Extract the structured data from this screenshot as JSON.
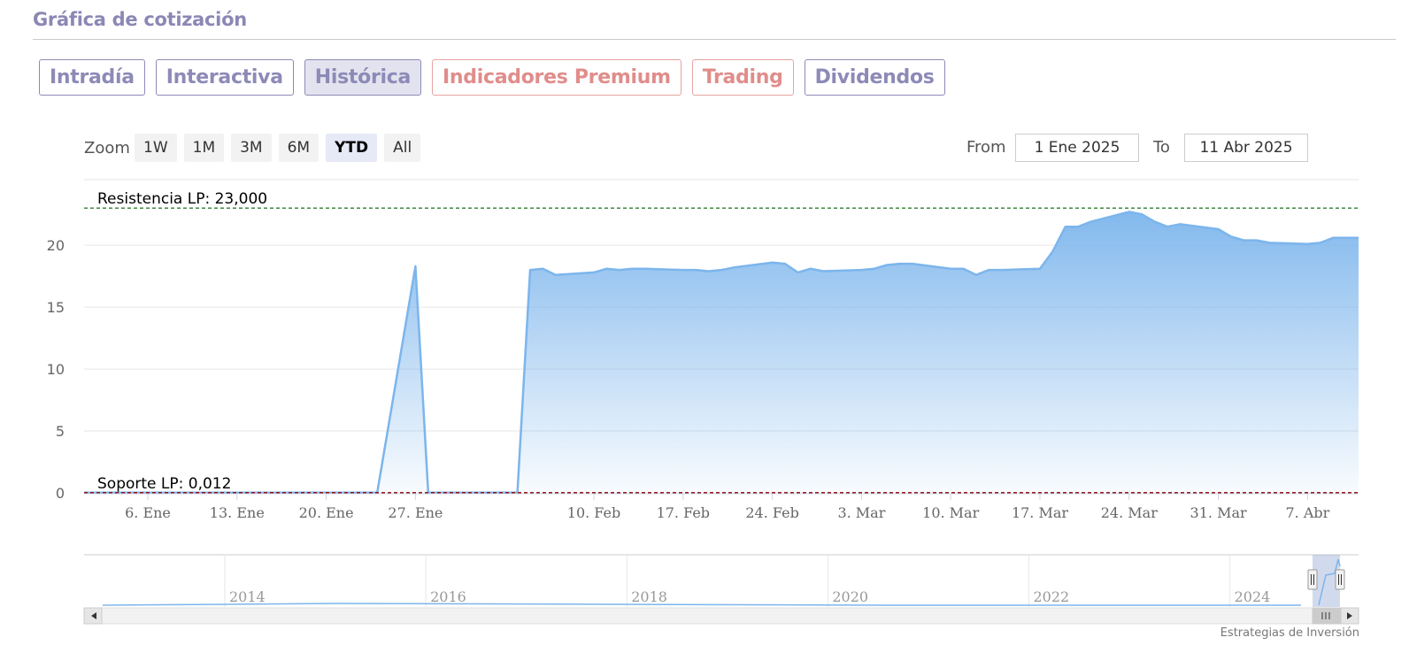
{
  "section_title": "Gráfica de cotización",
  "tabs": [
    {
      "label": "Intradía",
      "style": "normal"
    },
    {
      "label": "Interactiva",
      "style": "normal"
    },
    {
      "label": "Histórica",
      "style": "active"
    },
    {
      "label": "Indicadores Premium",
      "style": "premium"
    },
    {
      "label": "Trading",
      "style": "premium"
    },
    {
      "label": "Dividendos",
      "style": "normal"
    }
  ],
  "range_selector": {
    "zoom_label": "Zoom",
    "buttons": [
      "1W",
      "1M",
      "3M",
      "6M",
      "YTD",
      "All"
    ],
    "selected": "YTD",
    "from_label": "From",
    "from_value": "1 Ene 2025",
    "to_label": "To",
    "to_value": "11 Abr 2025"
  },
  "colors": {
    "accent": "#8d8ab7",
    "premium": "#e08d8b",
    "series_line": "#7cb5ec",
    "resistance_line": "#2e7d32",
    "support_line": "#8b0000"
  },
  "chart_data": {
    "type": "area",
    "x_unit": "date",
    "x": [
      "2025-01-01",
      "2025-01-06",
      "2025-01-13",
      "2025-01-20",
      "2025-01-24",
      "2025-01-27",
      "2025-01-28",
      "2025-02-03",
      "2025-02-04",
      "2025-02-05",
      "2025-02-06",
      "2025-02-07",
      "2025-02-10",
      "2025-02-11",
      "2025-02-12",
      "2025-02-13",
      "2025-02-14",
      "2025-02-17",
      "2025-02-18",
      "2025-02-19",
      "2025-02-20",
      "2025-02-21",
      "2025-02-24",
      "2025-02-25",
      "2025-02-26",
      "2025-02-27",
      "2025-02-28",
      "2025-03-03",
      "2025-03-04",
      "2025-03-05",
      "2025-03-06",
      "2025-03-07",
      "2025-03-10",
      "2025-03-11",
      "2025-03-12",
      "2025-03-13",
      "2025-03-14",
      "2025-03-17",
      "2025-03-18",
      "2025-03-19",
      "2025-03-20",
      "2025-03-21",
      "2025-03-24",
      "2025-03-25",
      "2025-03-26",
      "2025-03-27",
      "2025-03-28",
      "2025-03-31",
      "2025-04-01",
      "2025-04-02",
      "2025-04-03",
      "2025-04-04",
      "2025-04-07",
      "2025-04-08",
      "2025-04-09",
      "2025-04-10",
      "2025-04-11"
    ],
    "y": [
      0.012,
      0.012,
      0.012,
      0.012,
      0.012,
      18.3,
      0.012,
      0.012,
      0.012,
      18.0,
      18.1,
      17.6,
      17.8,
      18.1,
      18.0,
      18.1,
      18.1,
      18.0,
      18.0,
      17.9,
      18.0,
      18.2,
      18.6,
      18.5,
      17.8,
      18.1,
      17.9,
      18.0,
      18.1,
      18.4,
      18.5,
      18.5,
      18.1,
      18.1,
      17.6,
      18.0,
      18.0,
      18.1,
      19.5,
      21.5,
      21.5,
      21.9,
      22.7,
      22.5,
      21.9,
      21.5,
      21.7,
      21.3,
      20.7,
      20.4,
      20.4,
      20.2,
      20.1,
      20.2,
      20.6,
      20.6,
      20.6
    ],
    "ylim": [
      0,
      23
    ],
    "yticks": [
      "0",
      "5",
      "10",
      "15",
      "20"
    ],
    "xticks": [
      "6. Ene",
      "13. Ene",
      "20. Ene",
      "27. Ene",
      "10. Feb",
      "17. Feb",
      "24. Feb",
      "3. Mar",
      "10. Mar",
      "17. Mar",
      "24. Mar",
      "31. Mar",
      "7. Abr"
    ],
    "resistance_label": "Resistencia LP: 23,000",
    "resistance_value": 23.0,
    "support_label": "Soporte LP: 0,012",
    "support_value": 0.012,
    "grid": true,
    "navigator": {
      "year_labels": [
        "2014",
        "2016",
        "2018",
        "2020",
        "2022",
        "2024"
      ]
    },
    "credits": "Estrategias de Inversión"
  }
}
